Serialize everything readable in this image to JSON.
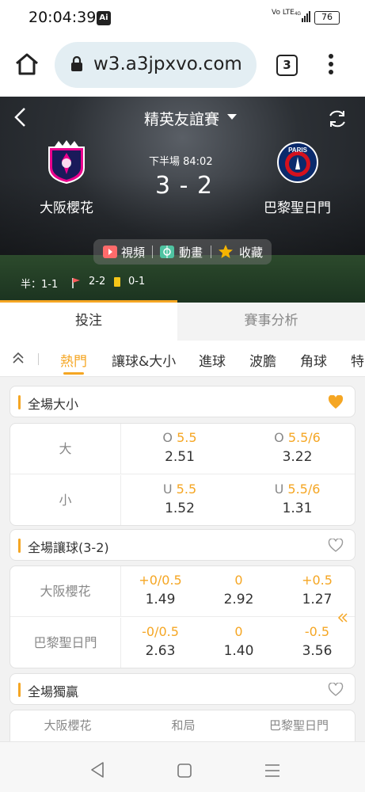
{
  "status": {
    "time": "20:04:39",
    "ai": "Ai",
    "net": "Vo LTE",
    "net2": "4G",
    "battery": "76"
  },
  "browser": {
    "url": "w3.a3jpxvo.com",
    "tab_count": "3"
  },
  "match": {
    "league": "精英友誼賽",
    "period": "下半場  84:02",
    "score": "3 - 2",
    "home": "大阪櫻花",
    "away": "巴黎聖日門",
    "media": {
      "video": "視頻",
      "animation": "動畫",
      "favorite": "收藏"
    },
    "stats": {
      "half": "半：1-1",
      "corners": "2-2",
      "cards": "0-1"
    }
  },
  "tabs": {
    "bet": "投注",
    "analysis": "賽事分析"
  },
  "subtabs": [
    "熱門",
    "讓球&大小",
    "進球",
    "波膽",
    "角球",
    "特"
  ],
  "sections": {
    "ou": {
      "title": "全場大小",
      "rows": [
        {
          "label": "大",
          "cells": [
            {
              "prefix": "O",
              "line": "5.5",
              "odds": "2.51"
            },
            {
              "prefix": "O",
              "line": "5.5/6",
              "odds": "3.22"
            }
          ]
        },
        {
          "label": "小",
          "cells": [
            {
              "prefix": "U",
              "line": "5.5",
              "odds": "1.52"
            },
            {
              "prefix": "U",
              "line": "5.5/6",
              "odds": "1.31"
            }
          ]
        }
      ]
    },
    "handicap": {
      "title": "全場讓球(3-2)",
      "rows": [
        {
          "label": "大阪櫻花",
          "cells": [
            {
              "line": "+0/0.5",
              "odds": "1.49"
            },
            {
              "line": "0",
              "odds": "2.92"
            },
            {
              "line": "+0.5",
              "odds": "1.27"
            }
          ]
        },
        {
          "label": "巴黎聖日門",
          "cells": [
            {
              "line": "-0/0.5",
              "odds": "2.63"
            },
            {
              "line": "0",
              "odds": "1.40"
            },
            {
              "line": "-0.5",
              "odds": "3.56"
            }
          ]
        }
      ]
    },
    "win": {
      "title": "全場獨贏",
      "headers": [
        "大阪櫻花",
        "和局",
        "巴黎聖日門"
      ]
    }
  },
  "colors": {
    "accent": "#f5a623"
  }
}
